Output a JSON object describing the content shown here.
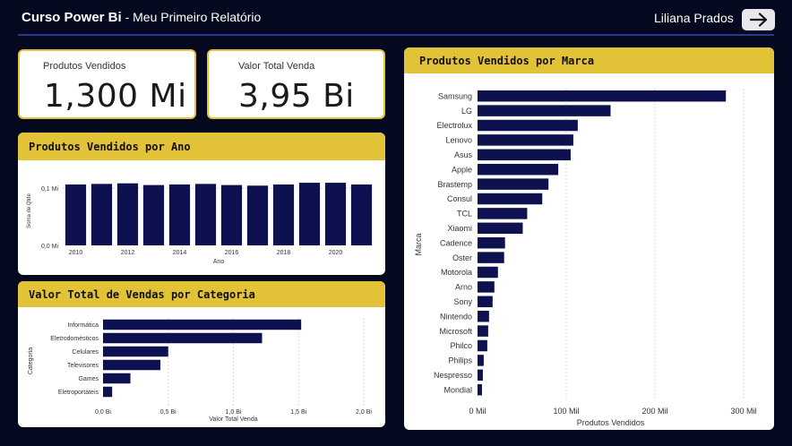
{
  "header": {
    "title_bold": "Curso Power Bi",
    "title_sub": " - Meu Primeiro Relatório",
    "user_name": "Liliana Prados",
    "nav_icon": "arrow-right-icon"
  },
  "kpis": [
    {
      "label": "Produtos Vendidos",
      "value": "1,300 Mi"
    },
    {
      "label": "Valor Total Venda",
      "value": "3,95 Bi"
    }
  ],
  "chart_data": [
    {
      "id": "ano",
      "type": "bar",
      "title": "Produtos Vendidos por Ano",
      "xlabel": "Ano",
      "ylabel": "Soma de Qtde",
      "categories": [
        "2010",
        "2011",
        "2012",
        "2013",
        "2014",
        "2015",
        "2016",
        "2017",
        "2018",
        "2019",
        "2020",
        "2021"
      ],
      "values": [
        0.106,
        0.107,
        0.108,
        0.105,
        0.106,
        0.107,
        0.105,
        0.104,
        0.106,
        0.109,
        0.109,
        0.106
      ],
      "x_tick_labels": [
        "2010",
        "2012",
        "2014",
        "2016",
        "2018",
        "2020"
      ],
      "y_ticks": [
        0,
        0.1
      ],
      "y_tick_labels": [
        "0,0 Mi",
        "0,1 Mi"
      ],
      "ylim": [
        0,
        0.12
      ],
      "bar_color": "#0d1150"
    },
    {
      "id": "categoria",
      "type": "bar",
      "orientation": "horizontal",
      "title": "Valor Total de Vendas por Categoria",
      "xlabel": "Valor Total Venda",
      "ylabel": "Categoria",
      "categories": [
        "Informática",
        "Eletrodomésticos",
        "Celulares",
        "Televisores",
        "Games",
        "Eletroportáteis"
      ],
      "values": [
        1.52,
        1.22,
        0.5,
        0.44,
        0.21,
        0.07
      ],
      "x_ticks": [
        0,
        0.5,
        1.0,
        1.5,
        2.0
      ],
      "x_tick_labels": [
        "0,0 Bi",
        "0,5 Bi",
        "1,0 Bi",
        "1,5 Bi",
        "2,0 Bi"
      ],
      "xlim": [
        0,
        2.0
      ],
      "bar_color": "#0d1150"
    },
    {
      "id": "marca",
      "type": "bar",
      "orientation": "horizontal",
      "title": "Produtos Vendidos por Marca",
      "xlabel": "Produtos Vendidos",
      "ylabel": "Marca",
      "categories": [
        "Samsung",
        "LG",
        "Electrolux",
        "Lenovo",
        "Asus",
        "Apple",
        "Brastemp",
        "Consul",
        "TCL",
        "Xiaomi",
        "Cadence",
        "Oster",
        "Motorola",
        "Arno",
        "Sony",
        "Nintendo",
        "Microsoft",
        "Philco",
        "Philips",
        "Nespresso",
        "Mondial"
      ],
      "values": [
        280000,
        150000,
        113000,
        108000,
        105000,
        91000,
        80000,
        73000,
        56000,
        51000,
        31000,
        30000,
        23000,
        19000,
        17000,
        13000,
        12000,
        11000,
        7000,
        6000,
        5000
      ],
      "x_ticks": [
        0,
        100000,
        200000,
        300000
      ],
      "x_tick_labels": [
        "0 Mil",
        "100 Mil",
        "200 Mil",
        "300 Mil"
      ],
      "xlim": [
        0,
        300000
      ],
      "bar_color": "#0d1150"
    }
  ]
}
